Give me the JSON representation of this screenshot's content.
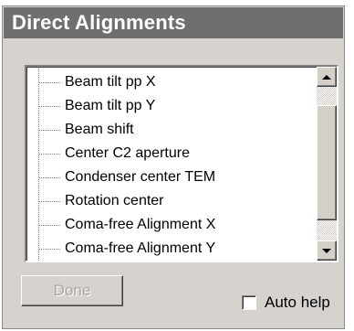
{
  "panel": {
    "title": "Direct Alignments"
  },
  "alignments": {
    "items": [
      {
        "label": "Beam tilt pp X"
      },
      {
        "label": "Beam tilt pp Y"
      },
      {
        "label": "Beam shift"
      },
      {
        "label": "Center C2 aperture"
      },
      {
        "label": "Condenser center TEM"
      },
      {
        "label": "Rotation center"
      },
      {
        "label": "Coma-free Alignment X"
      },
      {
        "label": "Coma-free Alignment Y"
      }
    ]
  },
  "footer": {
    "done_label": "Done",
    "auto_help_label": "Auto help",
    "auto_help_checked": false
  },
  "colors": {
    "titlebar_bg": "#6f6f6f",
    "panel_bg": "#d6d3ce",
    "disabled_text": "#a9a7a3"
  }
}
